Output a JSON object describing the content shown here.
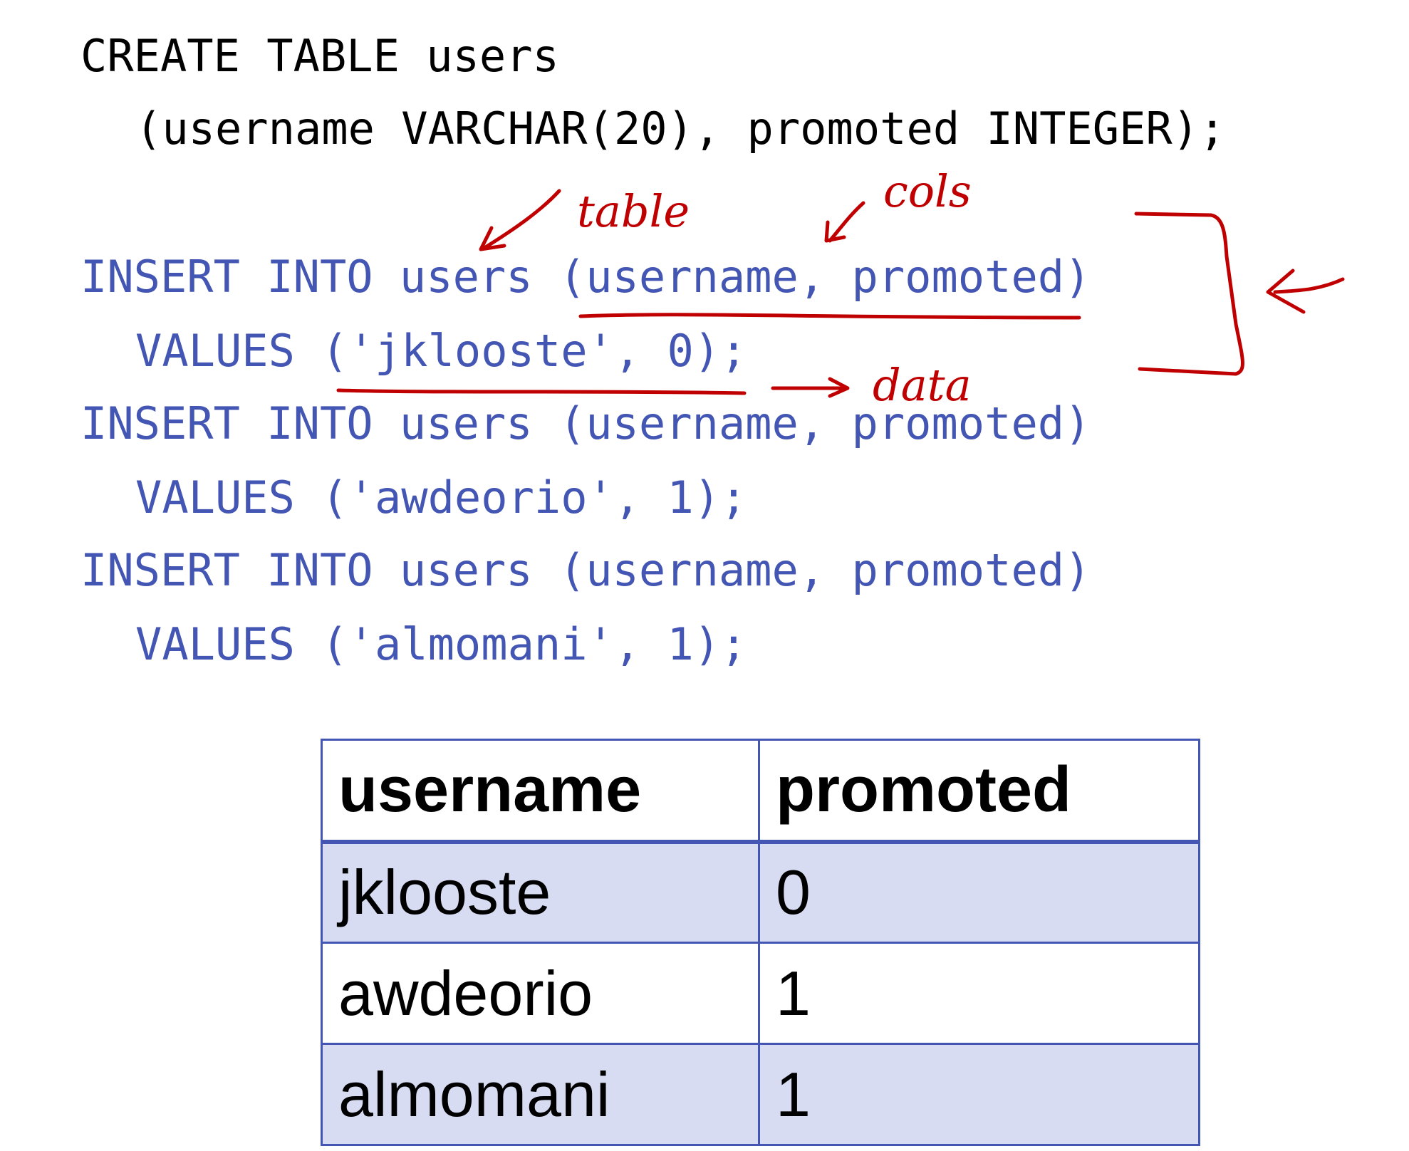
{
  "code": {
    "create_line_1": "CREATE TABLE users",
    "create_line_2": "(username VARCHAR(20), promoted INTEGER);",
    "inserts": [
      {
        "insert_line": "INSERT INTO users (username, promoted)",
        "values_line": "VALUES ('jklooste', 0);"
      },
      {
        "insert_line": "INSERT INTO users (username, promoted)",
        "values_line": "VALUES ('awdeorio', 1);"
      },
      {
        "insert_line": "INSERT INTO users (username, promoted)",
        "values_line": "VALUES ('almomani', 1);"
      }
    ]
  },
  "annotations": {
    "table_label": "table",
    "cols_label": "cols",
    "data_label": "data",
    "ink_color": "#c00000"
  },
  "result_table": {
    "headers": [
      "username",
      "promoted"
    ],
    "rows": [
      [
        "jklooste",
        "0"
      ],
      [
        "awdeorio",
        "1"
      ],
      [
        "almomani",
        "1"
      ]
    ],
    "border_color": "#4456b3",
    "shade_color": "#d8dcf2"
  },
  "colors": {
    "sql_keyword_blue": "#4456b3",
    "ddl_text_black": "#000000"
  }
}
